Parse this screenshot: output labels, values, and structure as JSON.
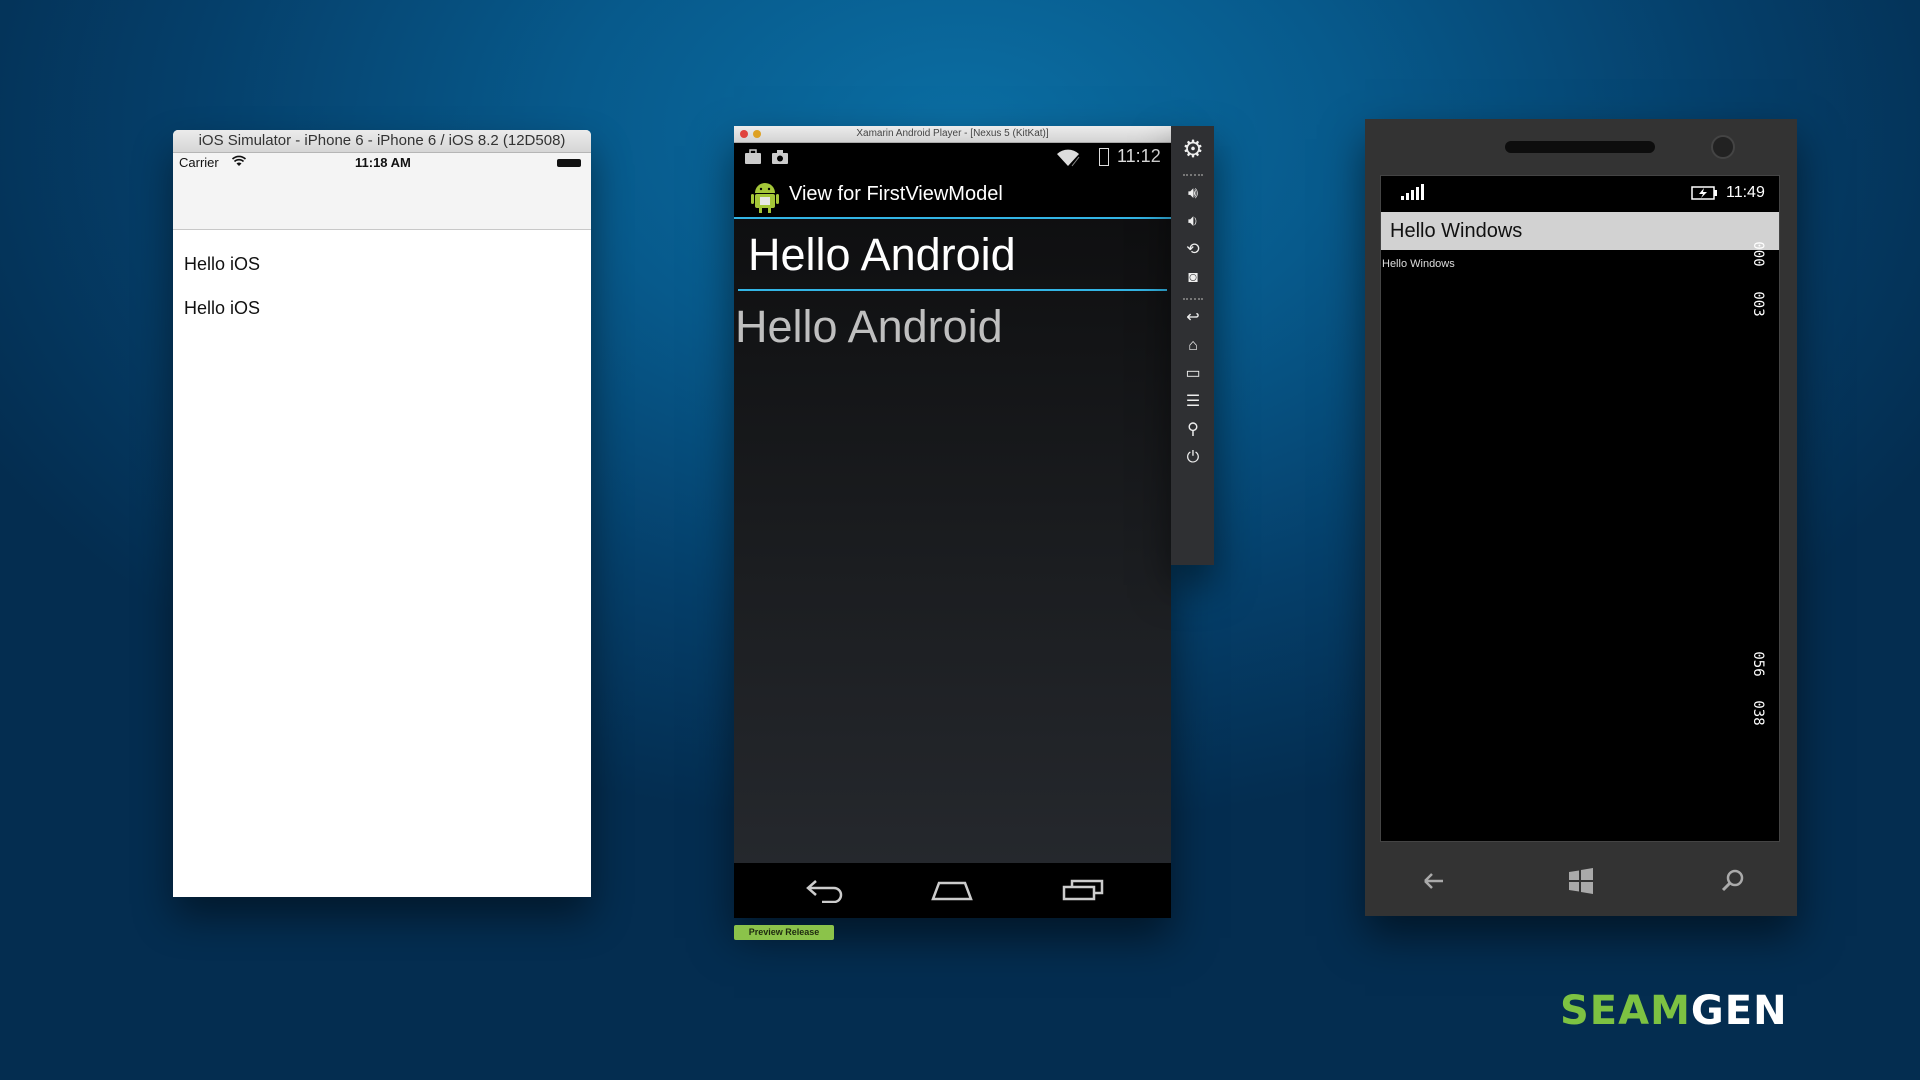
{
  "ios": {
    "window_title": "iOS Simulator - iPhone 6 - iPhone 6 / iOS 8.2 (12D508)",
    "carrier": "Carrier",
    "time": "11:18 AM",
    "labels": [
      "Hello iOS",
      "Hello iOS"
    ]
  },
  "android": {
    "window_title": "Xamarin Android Player - [Nexus 5 (KitKat)]",
    "time": "11:12",
    "actionbar_title": "View for FirstViewModel",
    "edittext_value": "Hello Android",
    "textview_value": "Hello Android",
    "badge": "Preview Release"
  },
  "windows": {
    "time": "11:49",
    "header": "Hello Windows",
    "body_text": "Hello Windows",
    "counters": [
      "000",
      "003",
      "056",
      "038"
    ]
  },
  "logo": {
    "part1": "SEAM",
    "part2": "GEN",
    "color1": "#7dc242",
    "color2": "#ffffff"
  }
}
